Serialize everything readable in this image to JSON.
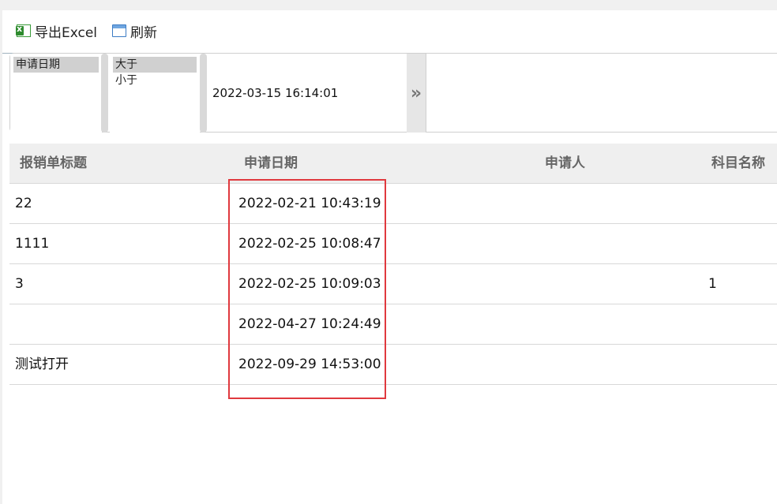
{
  "toolbar": {
    "export_label": "导出Excel",
    "refresh_label": "刷新"
  },
  "filter": {
    "fields": [
      {
        "label": "申请日期",
        "selected": true
      }
    ],
    "operators": [
      {
        "label": "大于",
        "selected": true
      },
      {
        "label": "小于",
        "selected": false
      }
    ],
    "value": "2022-03-15 16:14:01",
    "go_label": "»"
  },
  "table": {
    "columns": [
      "报销单标题",
      "申请日期",
      "申请人",
      "科目名称"
    ],
    "rows": [
      {
        "title": "22",
        "date": "2022-02-21 10:43:19",
        "applicant": "",
        "subject": ""
      },
      {
        "title": "1111",
        "date": "2022-02-25 10:08:47",
        "applicant": "",
        "subject": ""
      },
      {
        "title": "3",
        "date": "2022-02-25 10:09:03",
        "applicant": "",
        "subject": "1"
      },
      {
        "title": "",
        "date": "2022-04-27 10:24:49",
        "applicant": "",
        "subject": ""
      },
      {
        "title": "测试打开",
        "date": "2022-09-29 14:53:00",
        "applicant": "",
        "subject": ""
      }
    ]
  },
  "colors": {
    "highlight": "#e0393e",
    "header_bg": "#efefef",
    "selected_option": "#d0d0d0"
  }
}
